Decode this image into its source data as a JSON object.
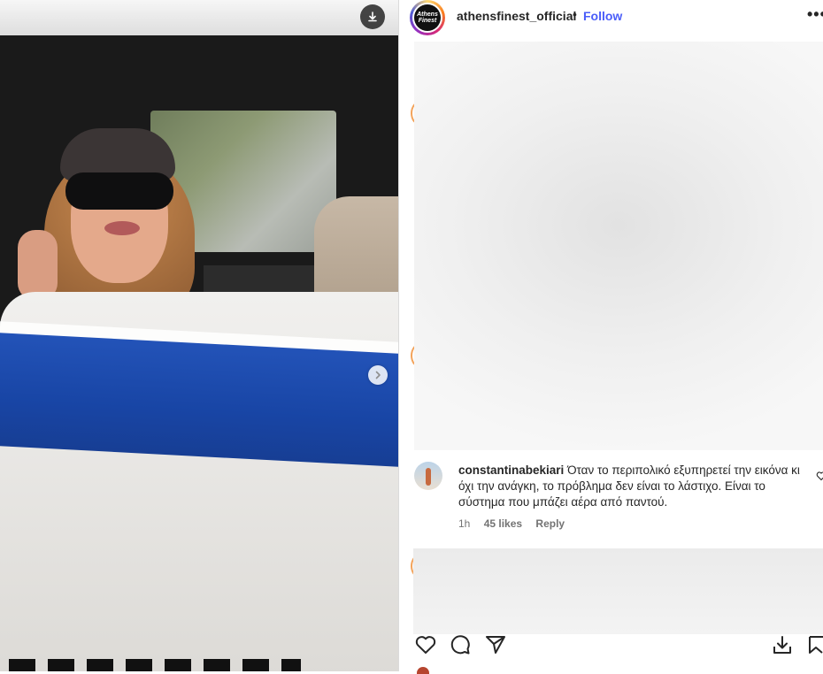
{
  "post": {
    "username": "athensfinest_official",
    "separator": "•",
    "follow_label": "Follow",
    "more_label": "•••",
    "avatar_text": "Athens Finest"
  },
  "media": {
    "download_icon": "download-icon",
    "next_icon": "chevron-right-icon"
  },
  "comment": {
    "username": "constantinabekiari",
    "text": "Όταν το περιπολικό εξυπηρετεί την εικόνα κι όχι την ανάγκη, το πρόβλημα δεν είναι το λάστιχο. Είναι το σύστημα που μπάζει αέρα από παντού.",
    "time": "1h",
    "likes": "45 likes",
    "reply_label": "Reply"
  },
  "actions": {
    "icons": [
      "heart-icon",
      "comment-icon",
      "share-icon",
      "save-icon"
    ]
  },
  "colors": {
    "follow": "#4a5df9",
    "text": "#262626",
    "muted": "#737373"
  }
}
